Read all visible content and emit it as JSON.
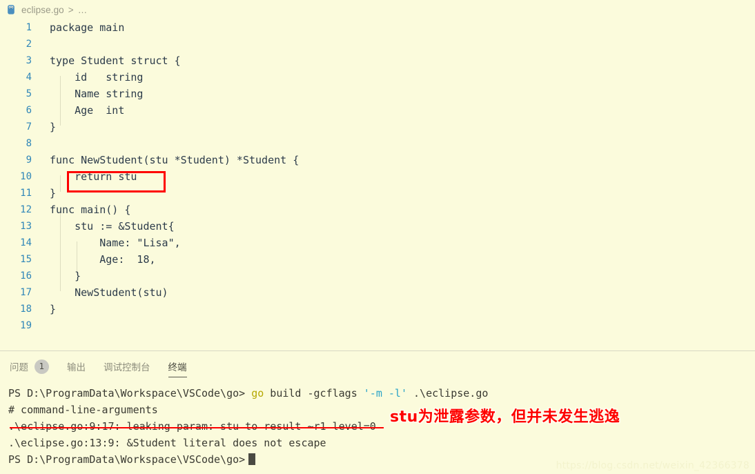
{
  "breadcrumb": {
    "file_icon": "go-file-icon",
    "file_name": "eclipse.go",
    "separator": ">",
    "ellipsis": "…"
  },
  "editor": {
    "lines": [
      {
        "num": "1",
        "text": "package main"
      },
      {
        "num": "2",
        "text": ""
      },
      {
        "num": "3",
        "text": "type Student struct {"
      },
      {
        "num": "4",
        "text": "    id   string"
      },
      {
        "num": "5",
        "text": "    Name string"
      },
      {
        "num": "6",
        "text": "    Age  int"
      },
      {
        "num": "7",
        "text": "}"
      },
      {
        "num": "8",
        "text": ""
      },
      {
        "num": "9",
        "text": "func NewStudent(stu *Student) *Student {"
      },
      {
        "num": "10",
        "text": "    return stu"
      },
      {
        "num": "11",
        "text": "}"
      },
      {
        "num": "12",
        "text": "func main() {"
      },
      {
        "num": "13",
        "text": "    stu := &Student{"
      },
      {
        "num": "14",
        "text": "        Name: \"Lisa\","
      },
      {
        "num": "15",
        "text": "        Age:  18,"
      },
      {
        "num": "16",
        "text": "    }"
      },
      {
        "num": "17",
        "text": "    NewStudent(stu)"
      },
      {
        "num": "18",
        "text": "}"
      },
      {
        "num": "19",
        "text": ""
      }
    ]
  },
  "panel": {
    "tabs": [
      {
        "label": "问题",
        "badge": "1",
        "active": false
      },
      {
        "label": "输出",
        "badge": "",
        "active": false
      },
      {
        "label": "调试控制台",
        "badge": "",
        "active": false
      },
      {
        "label": "终端",
        "badge": "",
        "active": true
      }
    ]
  },
  "terminal": {
    "prompt": "PS D:\\ProgramData\\Workspace\\VSCode\\go> ",
    "cmd_go": "go",
    "cmd_build": " build -gcflags ",
    "cmd_flags": "'-m -l'",
    "cmd_file": " .\\eclipse.go",
    "line_pkg": "# command-line-arguments",
    "line_leak": ".\\eclipse.go:9:17: leaking param: stu to result ~r1 level=0",
    "line_noescape": ".\\eclipse.go:13:9: &Student literal does not escape",
    "prompt_last": "PS D:\\ProgramData\\Workspace\\VSCode\\go>"
  },
  "annotations": {
    "red_note": "stu为泄露参数，但并未发生逃逸"
  },
  "watermark": {
    "text": "https://blog.csdn.net/weixin_42366378"
  },
  "colors": {
    "background": "#fbfbdc",
    "code_text": "#2c3b4a",
    "line_number": "#2f86b8",
    "annotation_red": "#fe0000",
    "flag_cyan": "#2aa3c7",
    "go_yellow": "#b5a800"
  }
}
